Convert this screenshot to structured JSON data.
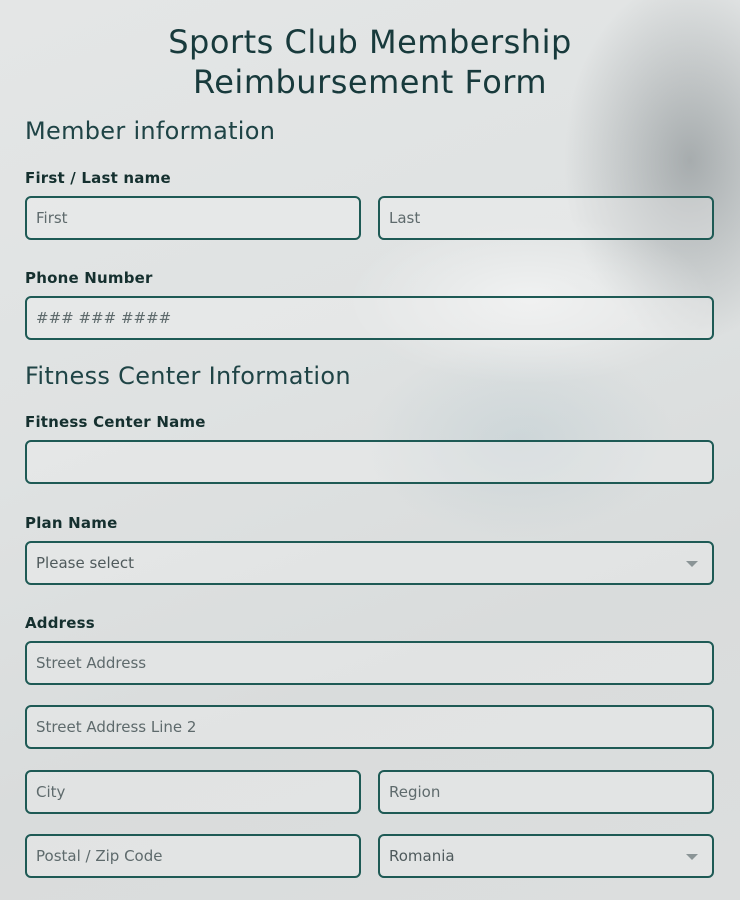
{
  "form": {
    "title_line1": "Sports Club Membership",
    "title_line2": "Reimbursement Form",
    "member_section": "Member information",
    "name_label": "First / Last name",
    "first_placeholder": "First",
    "last_placeholder": "Last",
    "phone_label": "Phone Number",
    "phone_placeholder": "### ### ####",
    "fitness_section": "Fitness Center Information",
    "center_name_label": "Fitness Center Name",
    "center_name_placeholder": "",
    "plan_label": "Plan Name",
    "plan_selected": "Please select",
    "address_label": "Address",
    "street_placeholder": "Street Address",
    "street2_placeholder": "Street Address Line 2",
    "city_placeholder": "City",
    "region_placeholder": "Region",
    "postal_placeholder": "Postal / Zip Code",
    "country_selected": "Romania"
  },
  "colors": {
    "accent": "#1e5a55",
    "title": "#183a3c",
    "background": "#dfe2e2"
  },
  "icons": {
    "plan_dropdown": "caret-down-icon",
    "country_dropdown": "caret-down-icon"
  }
}
